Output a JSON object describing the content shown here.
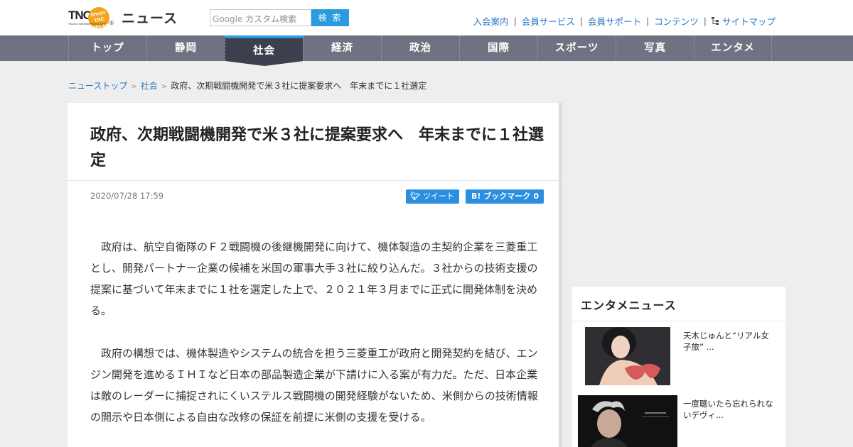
{
  "header": {
    "logo_text": "TNC",
    "logo_circle": "Shuyu TNC tnc.jp",
    "logo_sub": "TELEVI NISHINIPPON CORP",
    "logo_reg": "®",
    "site_title": "ニュース",
    "search": {
      "google_label": "Google",
      "placeholder": "カスタム検索",
      "button": "検 索"
    },
    "util_links": [
      "入会案内",
      "会員サービス",
      "会員サポート",
      "コンテンツ",
      "サイトマップ"
    ]
  },
  "nav": {
    "items": [
      "トップ",
      "静岡",
      "社会",
      "経済",
      "政治",
      "国際",
      "スポーツ",
      "写真",
      "エンタメ"
    ],
    "active_index": 2,
    "accent_color": "#2b9be0"
  },
  "breadcrumb": {
    "items": [
      "ニューストップ",
      "社会"
    ],
    "current": "政府、次期戦闘機開発で米３社に提案要求へ　年末までに１社選定"
  },
  "article": {
    "title": "政府、次期戦闘機開発で米３社に提案要求へ　年末までに１社選定",
    "date": "2020/07/28 17:59",
    "share": {
      "tweet": "ツイート",
      "hatena_label": "B! ブックマーク",
      "hatena_count": "0"
    },
    "paragraphs": [
      "政府は、航空自衛隊のＦ２戦闘機の後継機開発に向けて、機体製造の主契約企業を三菱重工とし、開発パートナー企業の候補を米国の軍事大手３社に絞り込んだ。３社からの技術支援の提案に基づいて年末までに１社を選定した上で、２０２１年３月までに正式に開発体制を決める。",
      "政府の構想では、機体製造やシステムの統合を担う三菱重工が政府と開発契約を結び、エンジン開発を進めるＩＨＩなど日本の部品製造企業が下請けに入る案が有力だ。ただ、日本企業は敵のレーダーに捕捉されにくいステルス戦闘機の開発経験がないため、米側からの技術情報の開示や日本側による自由な改修の保証を前提に米側の支援を受ける。"
    ]
  },
  "sidebar": {
    "title": "エンタメニュース",
    "items": [
      {
        "text": "天木じゅんと“リアル女子旅” ..."
      },
      {
        "text": "一度聴いたら忘れられないデヴィ..."
      }
    ]
  }
}
